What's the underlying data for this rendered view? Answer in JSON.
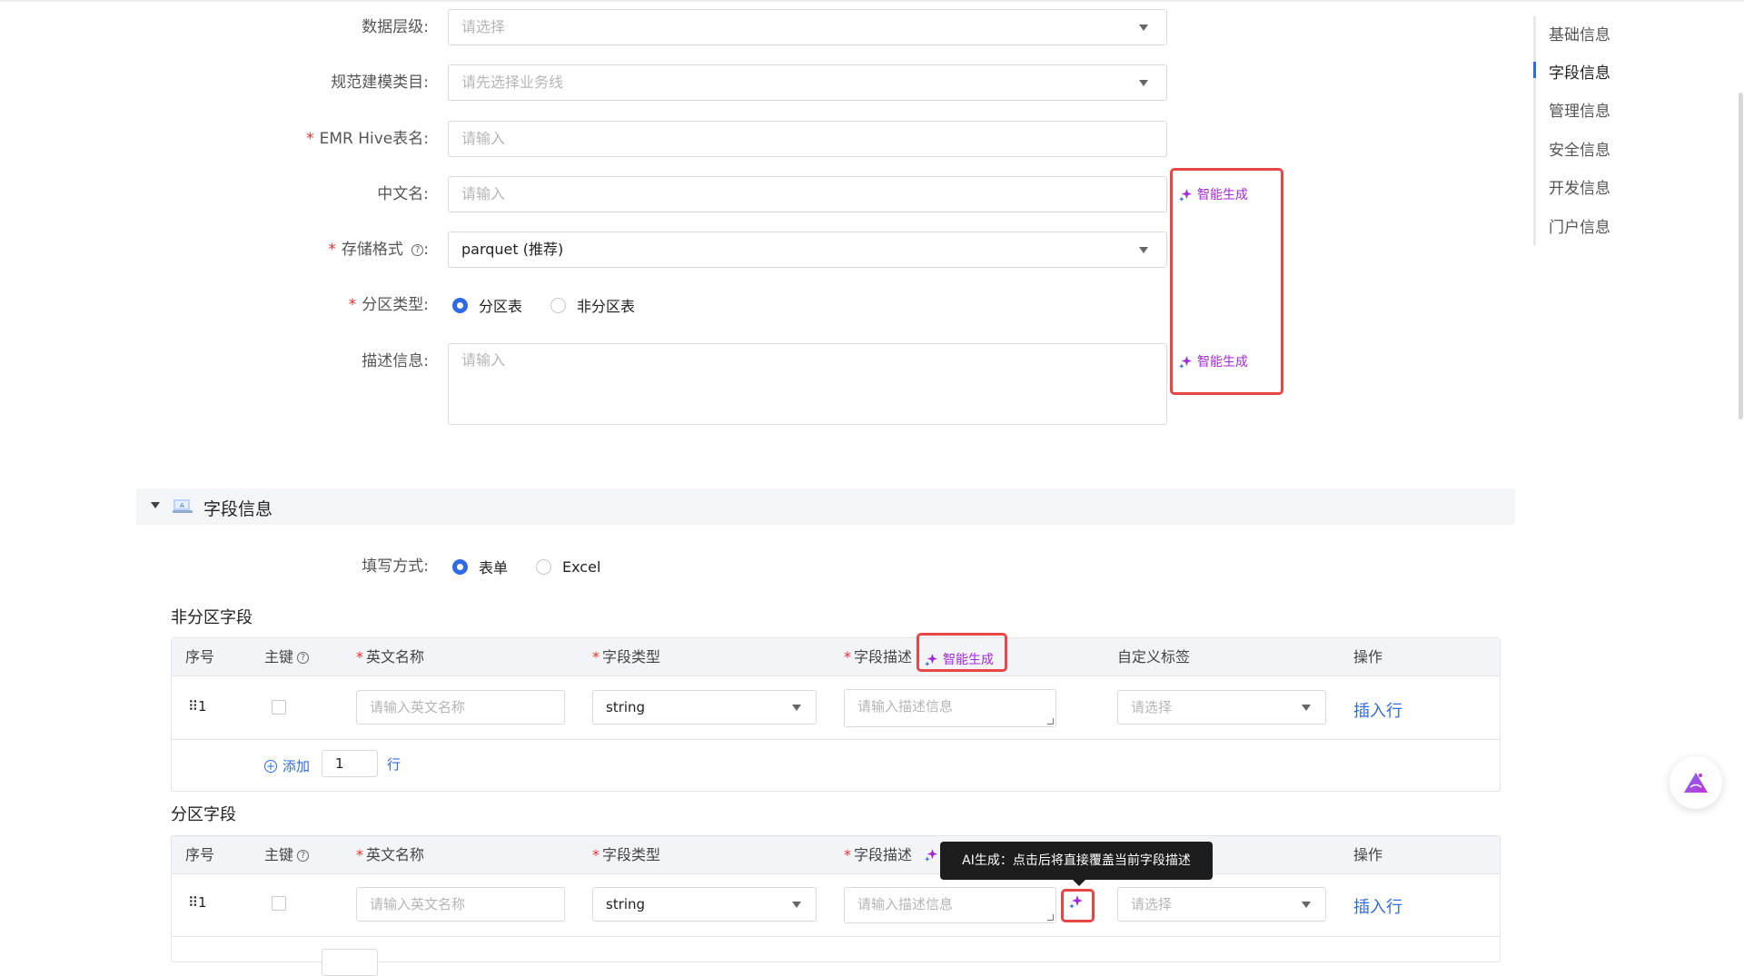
{
  "form": {
    "data_level": {
      "label": "数据层级:",
      "placeholder": "请选择"
    },
    "modeling_category": {
      "label": "规范建模类目:",
      "placeholder": "请先选择业务线"
    },
    "hive_table": {
      "label": "EMR Hive表名:",
      "placeholder": "请输入"
    },
    "cn_name": {
      "label": "中文名:",
      "placeholder": "请输入"
    },
    "storage_format": {
      "label": "存储格式",
      "label_suffix": ":",
      "value": "parquet (推荐)"
    },
    "partition_type": {
      "label": "分区类型:",
      "options": [
        "分区表",
        "非分区表"
      ],
      "selected": "分区表"
    },
    "description": {
      "label": "描述信息:",
      "placeholder": "请输入"
    },
    "ai_generate_label": "智能生成"
  },
  "right_nav": {
    "items": [
      "基础信息",
      "字段信息",
      "管理信息",
      "安全信息",
      "开发信息",
      "门户信息"
    ],
    "active": "字段信息"
  },
  "field_section": {
    "title": "字段信息",
    "fill_mode": {
      "label": "填写方式:",
      "options": [
        "表单",
        "Excel"
      ],
      "selected": "表单"
    },
    "columns": {
      "index": "序号",
      "primary_key": "主键",
      "en_name": "英文名称",
      "field_type": "字段类型",
      "field_desc": "字段描述",
      "custom_tag": "自定义标签",
      "actions": "操作"
    },
    "ai_generate_label": "智能生成",
    "non_partition": {
      "title": "非分区字段",
      "row": {
        "index": "1",
        "en_name_placeholder": "请输入英文名称",
        "type": "string",
        "desc_placeholder": "请输入描述信息",
        "tag_placeholder": "请选择",
        "insert_row": "插入行"
      },
      "add": {
        "label": "添加",
        "count": "1",
        "unit": "行"
      }
    },
    "partition": {
      "title": "分区字段",
      "row": {
        "index": "1",
        "en_name_placeholder": "请输入英文名称",
        "type": "string",
        "desc_placeholder": "请输入描述信息",
        "tag_placeholder": "请选择",
        "insert_row": "插入行"
      }
    },
    "tooltip": "AI生成：点击后将直接覆盖当前字段描述"
  },
  "colors": {
    "accent": "#2f6ae5",
    "ai_purple": "#a22ad6",
    "highlight_red": "#e84545",
    "required_red": "#ee2f2f"
  }
}
